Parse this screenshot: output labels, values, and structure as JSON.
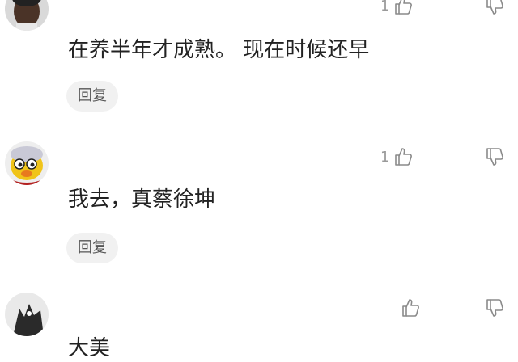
{
  "comments": [
    {
      "likes": "1",
      "text": "在养半年才成熟。 现在时候还早",
      "reply_label": "回复"
    },
    {
      "likes": "1",
      "text": "我去，真蔡徐坤",
      "reply_label": "回复"
    },
    {
      "likes": "",
      "text": "大美",
      "reply_label": ""
    }
  ],
  "icons": {
    "like": "thumb-up-icon",
    "dislike": "thumb-down-icon"
  },
  "colors": {
    "text": "#222222",
    "muted": "#9a9a9a",
    "reply_bg": "#f1f1f1"
  }
}
